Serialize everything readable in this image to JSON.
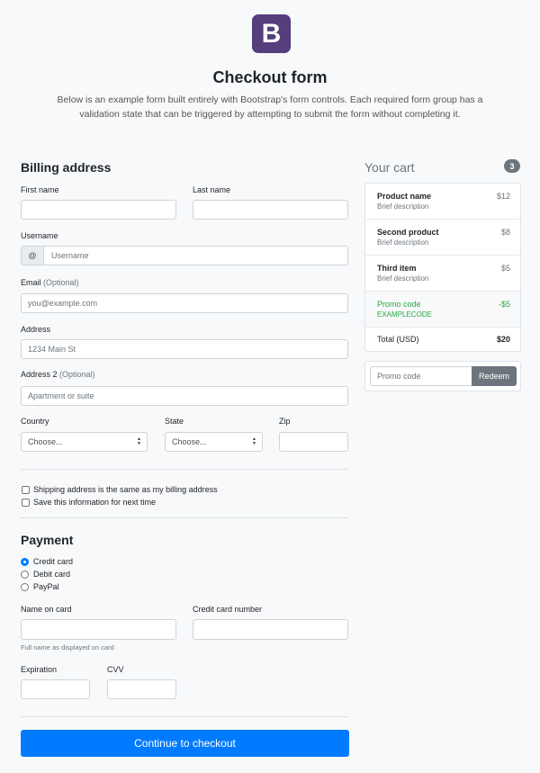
{
  "header": {
    "logo_letter": "B",
    "title": "Checkout form",
    "lead": "Below is an example form built entirely with Bootstrap's form controls. Each required form group has a validation state that can be triggered by attempting to submit the form without completing it."
  },
  "billing": {
    "heading": "Billing address",
    "first_name_label": "First name",
    "last_name_label": "Last name",
    "username_label": "Username",
    "username_prefix": "@",
    "username_placeholder": "Username",
    "email_label": "Email",
    "email_optional": "(Optional)",
    "email_placeholder": "you@example.com",
    "address_label": "Address",
    "address_placeholder": "1234 Main St",
    "address2_label": "Address 2",
    "address2_optional": "(Optional)",
    "address2_placeholder": "Apartment or suite",
    "country_label": "Country",
    "country_value": "Choose...",
    "state_label": "State",
    "state_value": "Choose...",
    "zip_label": "Zip"
  },
  "options": {
    "same_address": "Shipping address is the same as my billing address",
    "save_info": "Save this information for next time"
  },
  "payment": {
    "heading": "Payment",
    "methods": [
      "Credit card",
      "Debit card",
      "PayPal"
    ],
    "selected": "Credit card",
    "name_on_card_label": "Name on card",
    "name_on_card_help": "Full name as displayed on card",
    "card_number_label": "Credit card number",
    "expiration_label": "Expiration",
    "cvv_label": "CVV"
  },
  "cart": {
    "heading": "Your cart",
    "count": "3",
    "items": [
      {
        "name": "Product name",
        "desc": "Brief description",
        "price": "$12"
      },
      {
        "name": "Second product",
        "desc": "Brief description",
        "price": "$8"
      },
      {
        "name": "Third item",
        "desc": "Brief description",
        "price": "$5"
      }
    ],
    "promo": {
      "name": "Promo code",
      "code": "EXAMPLECODE",
      "amount": "-$5"
    },
    "total_label": "Total (USD)",
    "total_value": "$20",
    "promo_placeholder": "Promo code",
    "redeem_label": "Redeem"
  },
  "submit_label": "Continue to checkout",
  "colors": {
    "primary": "#007bff",
    "brand": "#563d7c",
    "success": "#28a745",
    "secondary": "#6c757d"
  }
}
